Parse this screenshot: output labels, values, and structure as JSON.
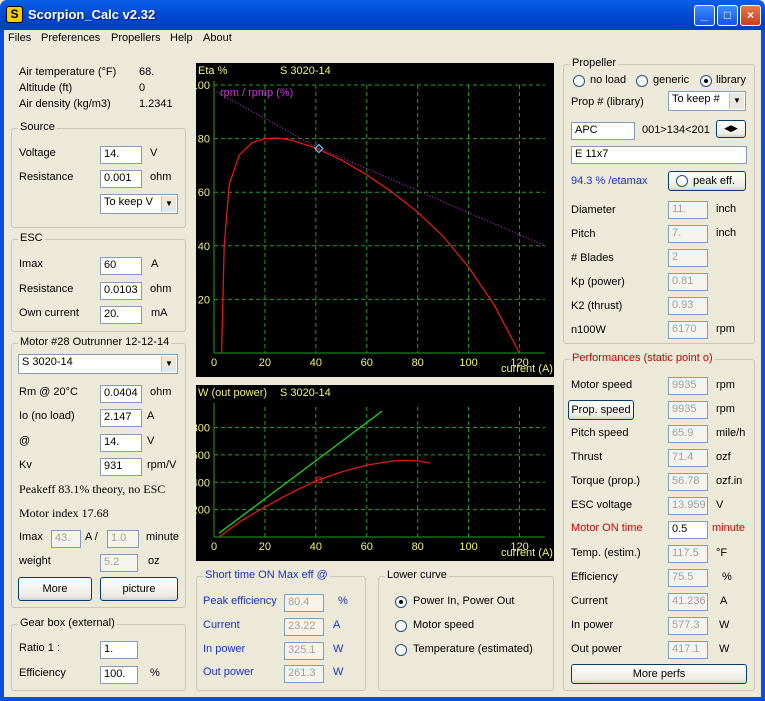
{
  "window": {
    "title": "Scorpion_Calc v2.32",
    "icon_label": "S",
    "controls": [
      "_",
      "□",
      "×"
    ]
  },
  "menu": [
    "Files",
    "Preferences",
    "Propellers",
    "Help",
    "About"
  ],
  "ambient": {
    "rows": [
      {
        "label": "Air temperature (°F)",
        "value": "68."
      },
      {
        "label": "Altitude (ft)",
        "value": "0"
      },
      {
        "label": "Air density (kg/m3)",
        "value": "1.2341"
      }
    ]
  },
  "source": {
    "title": "Source",
    "voltage_label": "Voltage",
    "voltage": "14.",
    "voltage_unit": "V",
    "resistance_label": "Resistance",
    "resistance": "0.001",
    "resistance_unit": "ohm",
    "mode": "To keep V"
  },
  "esc": {
    "title": "ESC",
    "imax_label": "Imax",
    "imax": "60",
    "imax_unit": "A",
    "resistance_label": "Resistance",
    "resistance": "0.0103",
    "resistance_unit": "ohm",
    "own_current_label": "Own current",
    "own_current": "20.",
    "own_current_unit": "mA"
  },
  "motor": {
    "title": "Motor #28   Outrunner 12-12-14",
    "model": "S 3020-14",
    "rm_label": "Rm @ 20°C",
    "rm": "0.0404",
    "rm_unit": "ohm",
    "io_label": "Io (no load)",
    "io": "2.147",
    "io_unit": "A",
    "at_label": "@",
    "at": "14.",
    "at_unit": "V",
    "kv_label": "Kv",
    "kv": "931",
    "kv_unit": "rpm/V",
    "peakeff_text": "Peakeff  83.1% theory, no ESC",
    "index_text": "Motor index  17.68",
    "imax_label": "Imax",
    "imax": "43.",
    "imax_sep": "A /",
    "imax_time": "1.0",
    "imax_time_unit": "minute",
    "weight_label": "weight",
    "weight": "5.2",
    "weight_unit": "oz",
    "more_button": "More",
    "picture_button": "picture"
  },
  "gearbox": {
    "title": "Gear box (external)",
    "ratio_label": "Ratio 1 :",
    "ratio": "1.",
    "eff_label": "Efficiency",
    "eff": "100.",
    "eff_unit": "%"
  },
  "chart_top": {
    "ylabel": "Eta %",
    "title": "S 3020-14",
    "series2_label": "rpm / rpmp (%)",
    "xlabel": "current (A)",
    "yticks": [
      "20",
      "40",
      "60",
      "80",
      "100"
    ],
    "xticks": [
      "0",
      "20",
      "40",
      "60",
      "80",
      "100",
      "120"
    ]
  },
  "chart_bottom": {
    "ylabel": "W (out power)",
    "title": "S 3020-14",
    "xlabel": "current (A)",
    "yticks": [
      "200",
      "400",
      "600",
      "800"
    ],
    "xticks": [
      "0",
      "20",
      "40",
      "60",
      "80",
      "100",
      "120"
    ]
  },
  "chart_data": [
    {
      "type": "line",
      "title": "S 3020-14",
      "xlabel": "current (A)",
      "ylabel": "Eta %",
      "xlim": [
        0,
        130
      ],
      "ylim": [
        0,
        100
      ],
      "grid": true,
      "series": [
        {
          "name": "Eta %",
          "color": "#E01818",
          "x": [
            3,
            4,
            6,
            10,
            15,
            20,
            25,
            30,
            40,
            50,
            60,
            70,
            80,
            90,
            100,
            110,
            120
          ],
          "y": [
            0,
            40,
            63,
            74,
            78.5,
            80,
            80.2,
            79.5,
            76.5,
            72,
            66.5,
            60,
            52.5,
            43.5,
            32,
            18,
            0
          ]
        },
        {
          "name": "rpm / rpmp (%)",
          "color": "#B020C8",
          "x": [
            0,
            40,
            130
          ],
          "y": [
            98,
            77,
            40
          ]
        }
      ],
      "marker": {
        "x": 41.2,
        "y": 76.3
      }
    },
    {
      "type": "line",
      "title": "S 3020-14",
      "xlabel": "current (A)",
      "ylabel": "W (out power)",
      "xlim": [
        0,
        130
      ],
      "ylim": [
        0,
        950
      ],
      "grid": true,
      "series": [
        {
          "name": "Power In",
          "color": "#20D020",
          "x": [
            2,
            66
          ],
          "y": [
            28,
            920
          ]
        },
        {
          "name": "Power Out",
          "color": "#E01818",
          "x": [
            2,
            10,
            20,
            30,
            40,
            50,
            60,
            70,
            75,
            80,
            85
          ],
          "y": [
            0,
            110,
            220,
            320,
            410,
            475,
            525,
            555,
            560,
            556,
            540
          ]
        }
      ],
      "marker": {
        "x": 41.2,
        "y": 417
      }
    }
  ],
  "short_time": {
    "title": "Short time ON Max eff @",
    "rows": [
      {
        "label": "Peak efficiency",
        "value": "80.4",
        "unit": "%"
      },
      {
        "label": "Current",
        "value": "23.22",
        "unit": "A"
      },
      {
        "label": "In power",
        "value": "325.1",
        "unit": "W"
      },
      {
        "label": "Out power",
        "value": "261.3",
        "unit": "W"
      }
    ]
  },
  "lower_curve": {
    "title": "Lower curve",
    "options": [
      "Power In, Power Out",
      "Motor speed",
      "Temperature (estimated)"
    ],
    "selected": 0
  },
  "propeller": {
    "title": "Propeller",
    "radio_options": [
      "no load",
      "generic",
      "library"
    ],
    "radio_selected": 2,
    "prop_label": "Prop # (library)",
    "prop_mode": "To keep #",
    "brand": "APC",
    "range": "001>134<201",
    "model": "E 11x7",
    "etamax": "94.3 % /etamax",
    "peak_eff_label": "peak eff.",
    "rows": [
      {
        "label": "Diameter",
        "value": "11.",
        "unit": "inch"
      },
      {
        "label": "Pitch",
        "value": "7.",
        "unit": "inch"
      },
      {
        "label": "# Blades",
        "value": "2",
        "unit": ""
      },
      {
        "label": "Kp (power)",
        "value": "0.81",
        "unit": ""
      },
      {
        "label": "K2 (thrust)",
        "value": "0.93",
        "unit": ""
      },
      {
        "label": "n100W",
        "value": "6170",
        "unit": "rpm"
      }
    ]
  },
  "performances": {
    "title": "Performances (static point o)",
    "motor_speed_label": "Motor speed",
    "motor_speed": "9935",
    "motor_speed_unit": "rpm",
    "prop_speed_button": "Prop. speed",
    "prop_speed": "9935",
    "prop_speed_unit": "rpm",
    "rows": [
      {
        "label": "Pitch speed",
        "value": "65.9",
        "unit": "mile/h"
      },
      {
        "label": "Thrust",
        "value": "71.4",
        "unit": "ozf"
      },
      {
        "label": "Torque (prop.)",
        "value": "56.78",
        "unit": "ozf.in"
      },
      {
        "label": "ESC voltage",
        "value": "13.959",
        "unit": "V"
      }
    ],
    "motor_on_label": "Motor ON time",
    "motor_on": "0.5",
    "motor_on_unit": "minute",
    "rows2": [
      {
        "label": "Temp. (estim.)",
        "value": "117.5",
        "unit": "°F"
      },
      {
        "label": "Efficiency",
        "value": "75.5",
        "unit": "%"
      },
      {
        "label": "Current",
        "value": "41.236",
        "unit": "A"
      },
      {
        "label": "In power",
        "value": "577.3",
        "unit": "W"
      },
      {
        "label": "Out power",
        "value": "417.1",
        "unit": "W"
      }
    ],
    "more_button": "More perfs"
  }
}
